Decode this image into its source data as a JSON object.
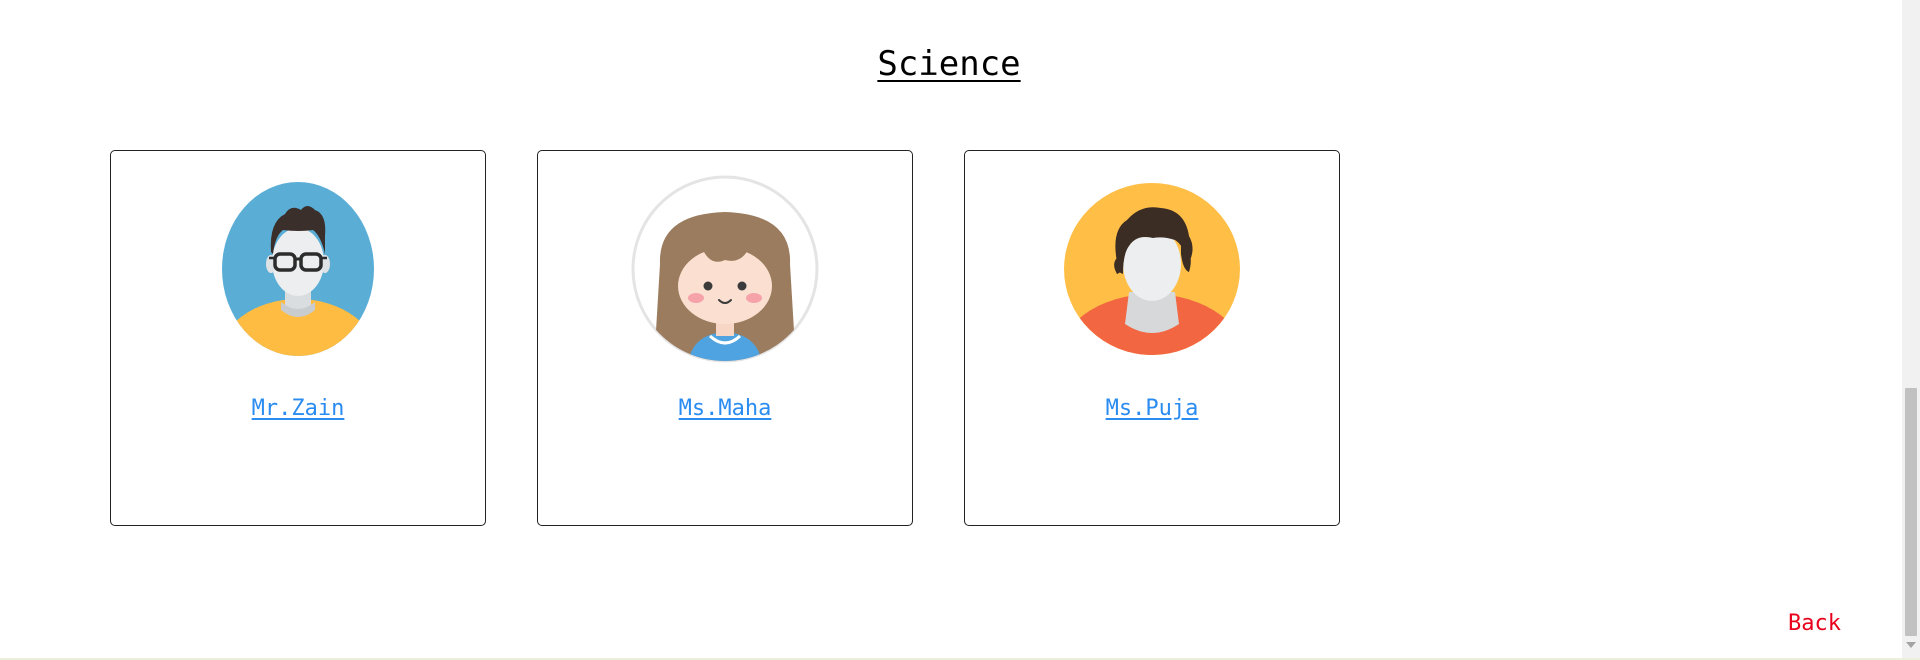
{
  "page": {
    "heading": "Science",
    "back_label": "Back"
  },
  "teachers": [
    {
      "name": "Mr.Zain",
      "avatar_icon": "male-glasses-avatar-icon"
    },
    {
      "name": "Ms.Maha",
      "avatar_icon": "girl-avatar-icon"
    },
    {
      "name": "Ms.Puja",
      "avatar_icon": "female-avatar-icon"
    }
  ],
  "colors": {
    "link": "#2a8cf0",
    "back_link": "#e8001c",
    "card_border": "#222222"
  }
}
